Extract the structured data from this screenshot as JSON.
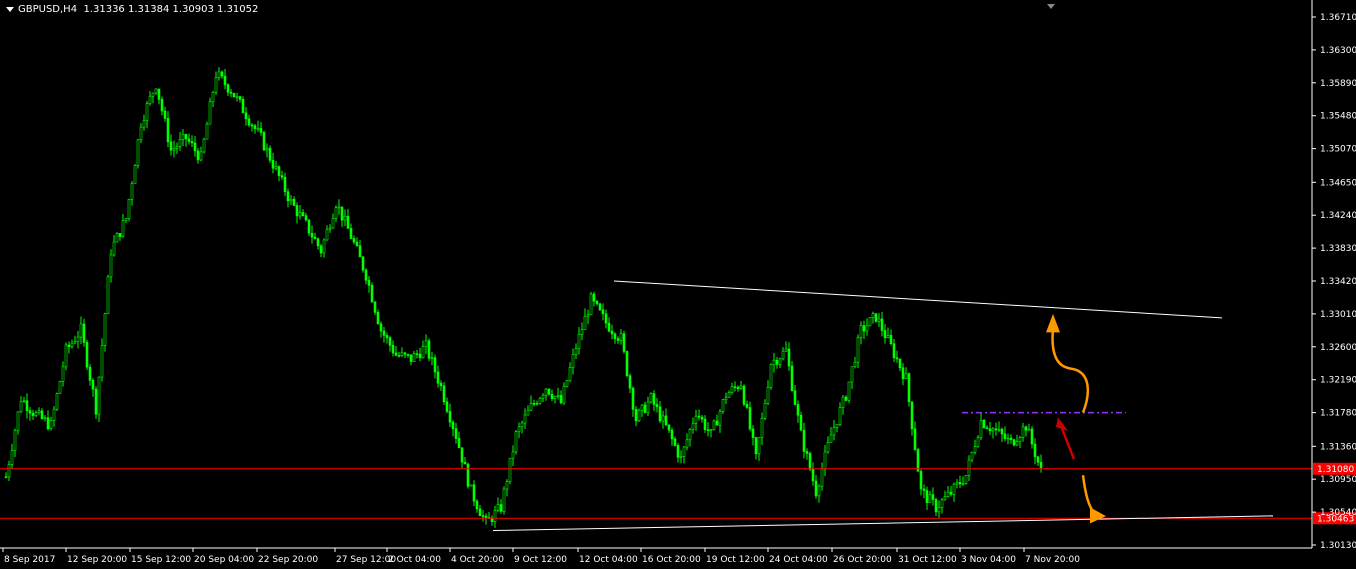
{
  "header": {
    "symbol": "GBPUSD,H4",
    "ohlc": "1.31336 1.31384 1.30903 1.31052"
  },
  "colors": {
    "background": "#000000",
    "candle": "#00ff00",
    "trendline": "#ffffff",
    "support_line": "#ff0000",
    "resistance_dash": "#9933ff",
    "arrow_orange": "#ff9900",
    "arrow_red": "#cc0000",
    "axis": "#ffffff"
  },
  "chart_data": {
    "type": "candlestick",
    "title": "GBPUSD,H4",
    "y_ticks": [
      "1.36710",
      "1.36300",
      "1.35890",
      "1.35480",
      "1.35070",
      "1.34650",
      "1.34240",
      "1.33830",
      "1.33420",
      "1.33010",
      "1.32600",
      "1.32190",
      "1.31780",
      "1.31360",
      "1.30950",
      "1.30540",
      "1.30130"
    ],
    "x_ticks": [
      "8 Sep 2017",
      "12 Sep 20:00",
      "15 Sep 12:00",
      "20 Sep 04:00",
      "22 Sep 20:00",
      "27 Sep 12:00",
      "2 Oct 04:00",
      "4 Oct 20:00",
      "9 Oct 12:00",
      "12 Oct 04:00",
      "16 Oct 20:00",
      "19 Oct 12:00",
      "24 Oct 04:00",
      "26 Oct 20:00",
      "31 Oct 12:00",
      "3 Nov 04:00",
      "7 Nov 20:00"
    ],
    "ylim": [
      1.3003,
      1.3682
    ],
    "grid": false,
    "price_levels": [
      {
        "label": "1.31080",
        "value": 1.3108
      },
      {
        "label": "1.30463",
        "value": 1.30463
      }
    ],
    "close_path": [
      1.3098,
      1.3196,
      1.3175,
      1.3162,
      1.3255,
      1.3281,
      1.3184,
      1.338,
      1.342,
      1.354,
      1.3588,
      1.3505,
      1.352,
      1.3495,
      1.36,
      1.358,
      1.355,
      1.352,
      1.348,
      1.344,
      1.3412,
      1.338,
      1.344,
      1.3398,
      1.335,
      1.3281,
      1.325,
      1.3245,
      1.326,
      1.321,
      1.315,
      1.308,
      1.304,
      1.306,
      1.315,
      1.3185,
      1.321,
      1.319,
      1.326,
      1.3318,
      1.329,
      1.327,
      1.317,
      1.3195,
      1.316,
      1.312,
      1.318,
      1.315,
      1.32,
      1.3215,
      1.312,
      1.324,
      1.3255,
      1.315,
      1.308,
      1.315,
      1.32,
      1.328,
      1.3298,
      1.326,
      1.322,
      1.308,
      1.306,
      1.3078,
      1.31,
      1.3168,
      1.3155,
      1.314,
      1.3162,
      1.3105
    ]
  }
}
